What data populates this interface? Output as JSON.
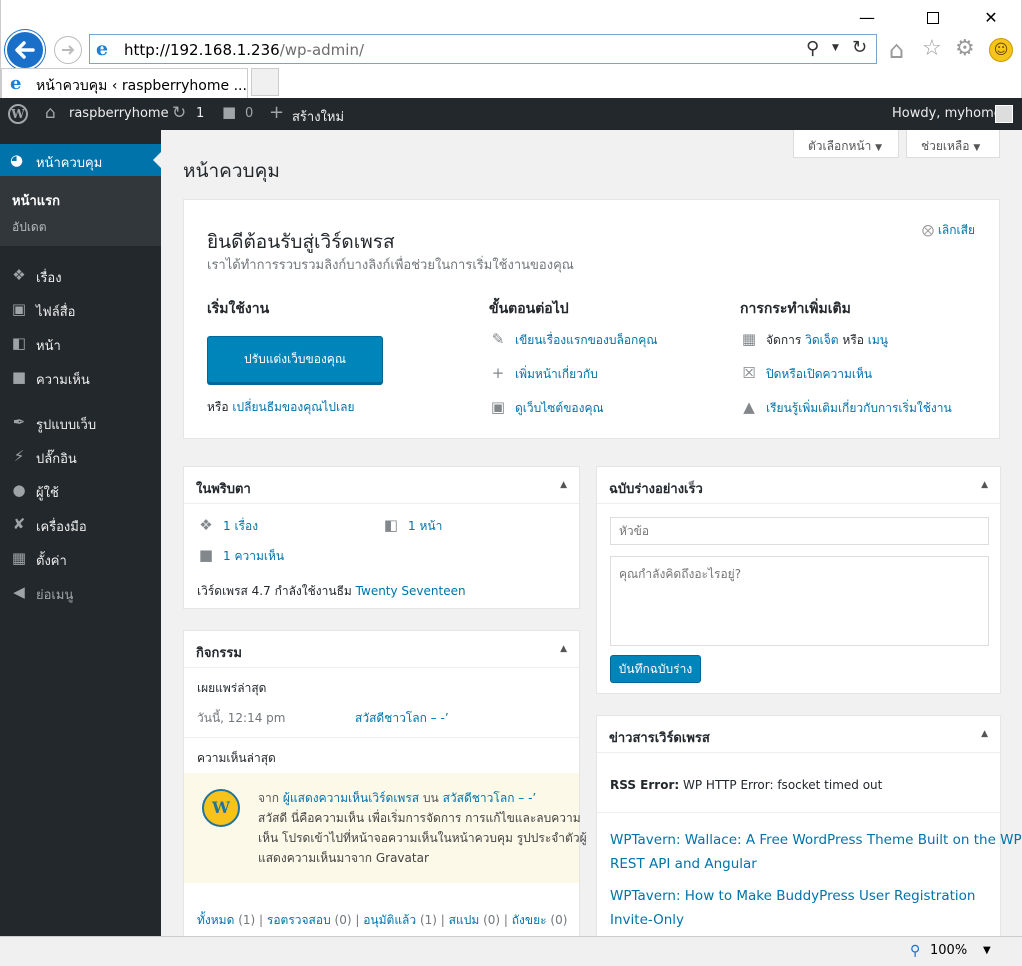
{
  "browser": {
    "url_host": "http://192.168.1.236",
    "url_path": "/wp-admin/",
    "tab_title": "หน้าควบคุม ‹ raspberryhome ...",
    "zoom": "100%"
  },
  "adminbar": {
    "site": "raspberryhome",
    "updates": "1",
    "comments": "0",
    "new": "สร้างใหม่",
    "howdy": "Howdy, myhome"
  },
  "sidebar": {
    "dashboard": "หน้าควบคุม",
    "sub_home": "หน้าแรก",
    "sub_updates": "อัปเดต",
    "items": [
      {
        "label": "เรื่อง",
        "icon": "pin-icon"
      },
      {
        "label": "ไฟล์สื่อ",
        "icon": "media-icon"
      },
      {
        "label": "หน้า",
        "icon": "page-icon"
      },
      {
        "label": "ความเห็น",
        "icon": "comment-icon"
      },
      {
        "label": "รูปแบบเว็บ",
        "icon": "brush-icon"
      },
      {
        "label": "ปลั๊กอิน",
        "icon": "plugin-icon"
      },
      {
        "label": "ผู้ใช้",
        "icon": "user-icon"
      },
      {
        "label": "เครื่องมือ",
        "icon": "wrench-icon"
      },
      {
        "label": "ตั้งค่า",
        "icon": "settings-icon"
      },
      {
        "label": "ย่อเมนู",
        "icon": "collapse-icon"
      }
    ]
  },
  "page": {
    "title": "หน้าควบคุม",
    "screen_options": "ตัวเลือกหน้า",
    "help": "ช่วยเหลือ"
  },
  "welcome": {
    "title": "ยินดีต้อนรับสู่เวิร์ดเพรส",
    "subtitle": "เราได้ทำการรวบรวมลิงก์บางลิงก์เพื่อช่วยในการเริ่มใช้งานของคุณ",
    "dismiss": "เลิกเสีย",
    "col1_title": "เริ่มใช้งาน",
    "customize_btn": "ปรับแต่งเว็บของคุณ",
    "or": "หรือ",
    "change_theme": "เปลี่ยนธีมของคุณไปเลย",
    "col2_title": "ขั้นตอนต่อไป",
    "next1": "เขียนเรื่องแรกของบล็อกคุณ",
    "next2": "เพิ่มหน้าเกี่ยวกับ",
    "next3": "ดูเว็บไซต์ของคุณ",
    "col3_title": "การกระทำเพิ่มเติม",
    "more1_pre": "จัดการ",
    "more1_widget": "วิดเจ็ต",
    "more1_or": "หรือ",
    "more1_menu": "เมนู",
    "more2": "ปิดหรือเปิดความเห็น",
    "more3": "เรียนรู้เพิ่มเติมเกี่ยวกับการเริ่มใช้งาน"
  },
  "glance": {
    "title": "ในพริบตา",
    "posts": "1 เรื่อง",
    "pages": "1 หน้า",
    "comments": "1 ความเห็น",
    "version_text": "เวิร์ดเพรส 4.7 กำลังใช้งานธีม",
    "theme": "Twenty Seventeen"
  },
  "activity": {
    "title": "กิจกรรม",
    "recent_published": "เผยแพร่ล่าสุด",
    "pub_time": "วันนี้, 12:14 pm",
    "pub_post": "สวัสดีชาวโลก – -’",
    "recent_comments": "ความเห็นล่าสุด",
    "from": "จาก",
    "commenter": "ผู้แสดงความเห็นเวิร์ดเพรส",
    "on": "บน",
    "comment_post": "สวัสดีชาวโลก – -’",
    "comment_line1": "สวัสดี นี่คือความเห็น เพื่อเริ่มการจัดการ การแก้ไขและลบความ",
    "comment_line2": "เห็น โปรดเข้าไปที่หน้าจอความเห็นในหน้าควบคุม รูปประจำตัวผู้",
    "comment_line3": "แสดงความเห็นมาจาก Gravatar",
    "f_all": "ทั้งหมด",
    "f_all_n": "(1)",
    "f_pending": "รอตรวจสอบ",
    "f_pending_n": "(0)",
    "f_approved": "อนุมัติแล้ว",
    "f_approved_n": "(1)",
    "f_spam": "สแปม",
    "f_spam_n": "(0)",
    "f_trash": "ถังขยะ",
    "f_trash_n": "(0)"
  },
  "quickdraft": {
    "title": "ฉบับร่างอย่างเร็ว",
    "title_placeholder": "หัวข้อ",
    "content_placeholder": "คุณกำลังคิดถึงอะไรอยู่?",
    "save": "บันทึกฉบับร่าง"
  },
  "news": {
    "title": "ข่าวสารเวิร์ดเพรส",
    "error_label": "RSS Error:",
    "error_text": "WP HTTP Error: fsocket timed out",
    "item1_line1": "WPTavern: Wallace: A Free WordPress Theme Built on the WP",
    "item1_line2": "REST API and Angular",
    "item2_line1": "WPTavern: How to Make BuddyPress User Registration",
    "item2_line2": "Invite-Only"
  }
}
